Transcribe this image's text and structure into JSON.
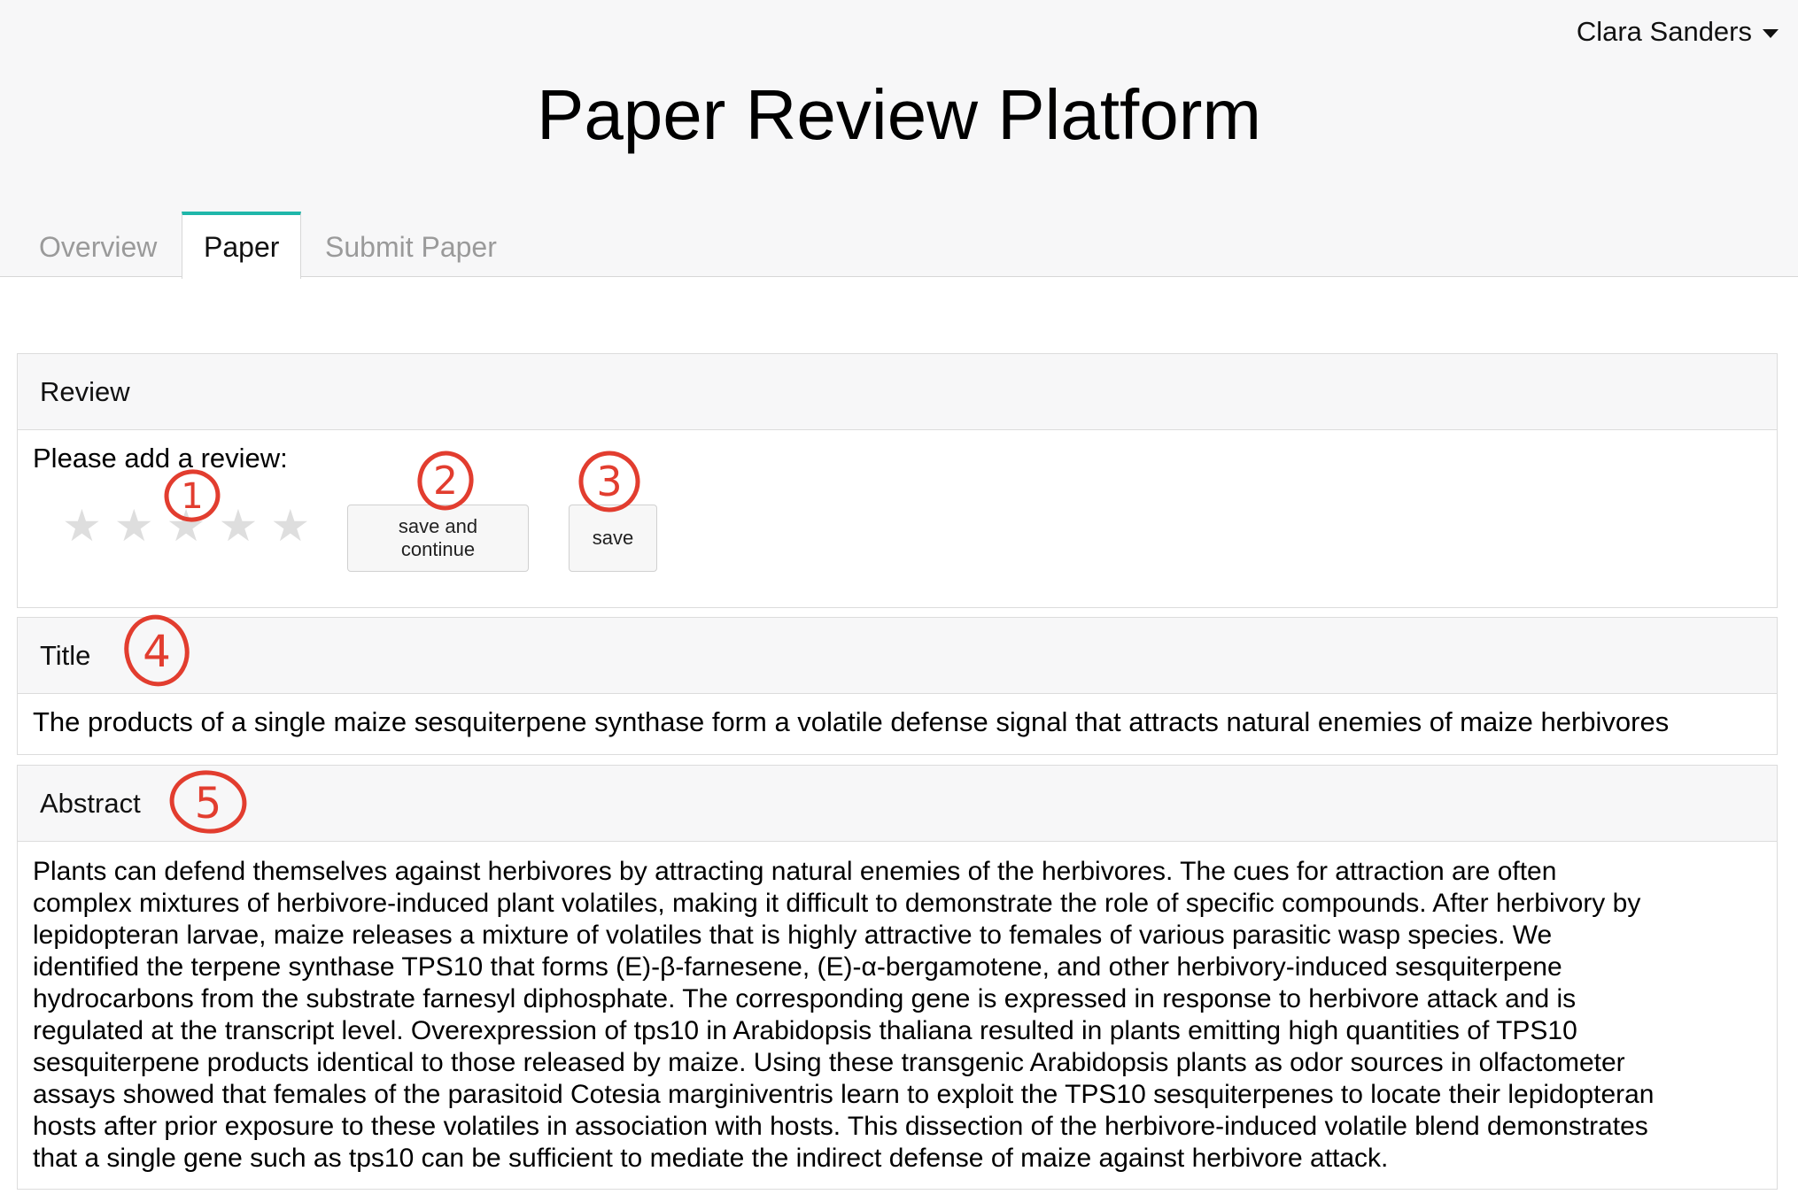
{
  "header": {
    "user_name": "Clara Sanders",
    "title": "Paper Review Platform"
  },
  "tabs": [
    {
      "label": "Overview",
      "active": false
    },
    {
      "label": "Paper",
      "active": true
    },
    {
      "label": "Submit Paper",
      "active": false
    }
  ],
  "review": {
    "heading": "Review",
    "prompt": "Please add a review:",
    "stars_total": 5,
    "stars_selected": 0,
    "save_continue_label": "save and continue",
    "save_label": "save"
  },
  "paper": {
    "title_heading": "Title",
    "title": "The products of a single maize sesquiterpene synthase form a volatile defense signal that attracts natural enemies of maize herbivores",
    "abstract_heading": "Abstract",
    "abstract_lines": [
      "Plants can defend themselves against herbivores by attracting natural enemies of the herbivores. The cues for attraction are often",
      "complex mixtures of herbivore-induced plant volatiles, making it difficult to demonstrate the role of specific compounds. After herbivory by",
      "lepidopteran larvae, maize releases a mixture of volatiles that is highly attractive to females of various parasitic wasp species. We",
      "identified the terpene synthase TPS10 that forms (E)-β-farnesene, (E)-α-bergamotene, and other herbivory-induced sesquiterpene",
      "hydrocarbons from the substrate farnesyl diphosphate. The corresponding gene is expressed in response to herbivore attack and is",
      "regulated at the transcript level. Overexpression of tps10 in Arabidopsis thaliana resulted in plants emitting high quantities of TPS10",
      "sesquiterpene products identical to those released by maize. Using these transgenic Arabidopsis plants as odor sources in olfactometer",
      "assays showed that females of the parasitoid Cotesia marginiventris learn to exploit the TPS10 sesquiterpenes to locate their lepidopteran",
      "hosts after prior exposure to these volatiles in association with hosts. This dissection of the herbivore-induced volatile blend demonstrates",
      "that a single gene such as tps10 can be sufficient to mediate the indirect defense of maize against herbivore attack."
    ]
  },
  "annotations": [
    "1",
    "2",
    "3",
    "4",
    "5"
  ],
  "colors": {
    "tab_accent": "#1fb7aa",
    "annotation_red": "#e23d2f",
    "star_empty": "#dedede"
  }
}
